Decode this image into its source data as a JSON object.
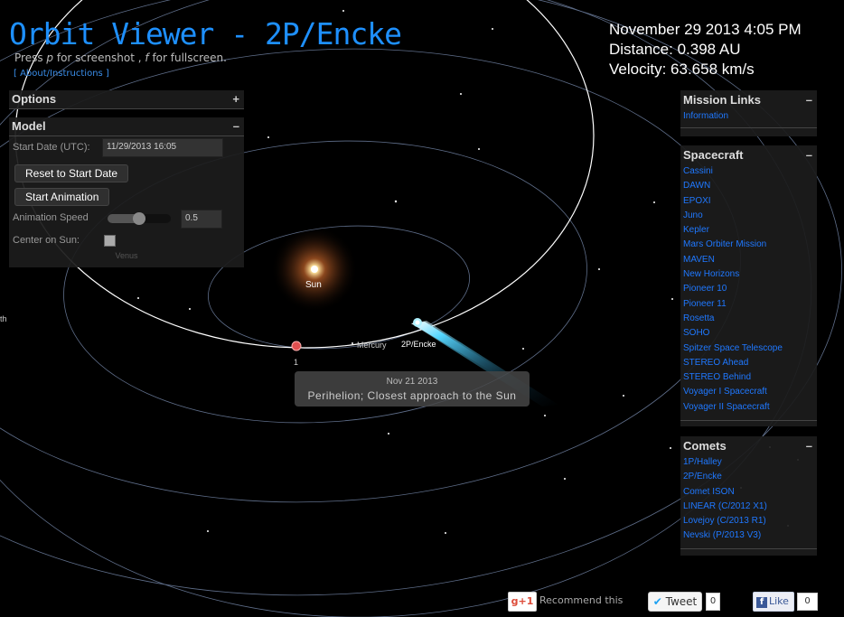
{
  "app": {
    "title": "Orbit Viewer - 2P/Encke",
    "subtitle_pre": "Press ",
    "subtitle_key1": "p",
    "subtitle_mid": " for screenshot , ",
    "subtitle_key2": "f",
    "subtitle_post": " for fullscreen.",
    "about_link": "[ About/Instructions ]"
  },
  "readout": {
    "date": "November 29 2013 4:05 PM",
    "distance": "Distance: 0.398 AU",
    "velocity": "Velocity: 63.658 km/s"
  },
  "options": {
    "label": "Options",
    "toggle": "+"
  },
  "model": {
    "label": "Model",
    "toggle": "–",
    "start_date_label": "Start Date (UTC):",
    "start_date_value": "11/29/2013 16:05",
    "reset_button": "Reset to Start Date",
    "start_button": "Start Animation",
    "speed_label": "Animation Speed",
    "speed_value": "0.5",
    "speed_fraction": 0.5,
    "center_label": "Center on Sun:",
    "center_checked": false,
    "faded_row": "Venus"
  },
  "mission_links": {
    "title": "Mission Links",
    "toggle": "–",
    "items": [
      "Information"
    ]
  },
  "spacecraft": {
    "title": "Spacecraft",
    "toggle": "–",
    "items": [
      "Cassini",
      "DAWN",
      "EPOXI",
      "Juno",
      "Kepler",
      "Mars Orbiter Mission",
      "MAVEN",
      "New Horizons",
      "Pioneer 10",
      "Pioneer 11",
      "Rosetta",
      "SOHO",
      "Spitzer Space Telescope",
      "STEREO Ahead",
      "STEREO Behind",
      "Voyager I Spacecraft",
      "Voyager II Spacecraft"
    ]
  },
  "comets": {
    "title": "Comets",
    "toggle": "–",
    "items": [
      "1P/Halley",
      "2P/Encke",
      "Comet ISON",
      "LINEAR (C/2012 X1)",
      "Lovejoy (C/2013 R1)",
      "Nevski (P/2013 V3)"
    ]
  },
  "scene": {
    "sun_label": "Sun",
    "mercury_label": "Mercury",
    "comet_label": "2P/Encke",
    "marker_label": "1",
    "edge_label": "th"
  },
  "tooltip": {
    "date": "Nov 21 2013",
    "event": "Perihelion; Closest approach to the Sun"
  },
  "social": {
    "gplus": "g+1",
    "recommend": "Recommend this",
    "tweet_bird": "✔",
    "tweet": "Tweet",
    "tweet_count": "0",
    "fb_f": "f",
    "like": "Like",
    "like_count": "0"
  },
  "colors": {
    "title": "#1e90ff",
    "link": "#1f78ff",
    "orbit": "#6f7f9a",
    "comet_orbit": "#ffffff",
    "sun": "#ffcc66"
  }
}
